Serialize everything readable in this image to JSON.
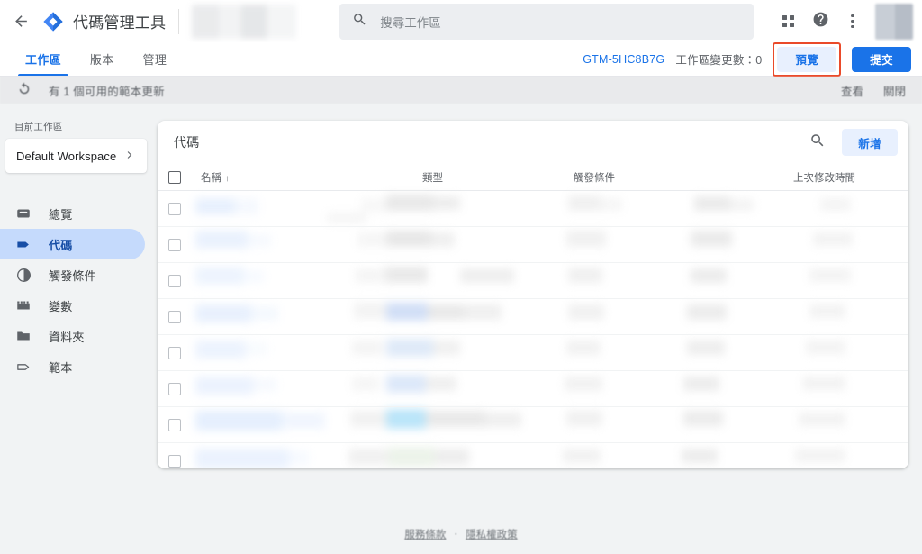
{
  "app": {
    "title": "代碼管理工具",
    "logo_icon": "gtm-diamond-icon",
    "back_icon": "back-arrow-icon"
  },
  "search": {
    "placeholder": "搜尋工作區",
    "value": "",
    "icon": "search-icon"
  },
  "topbar_right": {
    "apps_icon": "apps-grid-icon",
    "help_icon": "help-circle-icon",
    "more_icon": "more-vertical-icon",
    "avatar": "user-avatar"
  },
  "tabs": [
    {
      "label": "工作區",
      "active": true
    },
    {
      "label": "版本",
      "active": false
    },
    {
      "label": "管理",
      "active": false
    }
  ],
  "workspace_bar": {
    "container_id": "GTM-5HC8B7G",
    "changes_label": "工作區變更數：0",
    "preview_label": "預覽",
    "submit_label": "提交",
    "preview_highlight_color": "#ea4a2a"
  },
  "notification": {
    "icon": "update-refresh-icon",
    "message": "有 1 個可用的範本更新",
    "actions": [
      "查看",
      "關閉"
    ]
  },
  "sidebar": {
    "current_workspace_label": "目前工作區",
    "workspace_name": "Default Workspace",
    "workspace_chevron_icon": "chevron-right-icon",
    "items": [
      {
        "label": "總覽",
        "icon": "overview-box-icon",
        "active": false
      },
      {
        "label": "代碼",
        "icon": "tag-icon",
        "active": true
      },
      {
        "label": "觸發條件",
        "icon": "trigger-circle-icon",
        "active": false
      },
      {
        "label": "變數",
        "icon": "variables-icon",
        "active": false
      },
      {
        "label": "資料夾",
        "icon": "folder-icon",
        "active": false
      },
      {
        "label": "範本",
        "icon": "template-tag-icon",
        "active": false
      }
    ]
  },
  "main": {
    "card_title": "代碼",
    "search_icon": "search-icon",
    "add_label": "新增",
    "columns": [
      {
        "key": "checkbox",
        "label": ""
      },
      {
        "key": "name",
        "label": "名稱",
        "sort": "↑"
      },
      {
        "key": "type",
        "label": "類型"
      },
      {
        "key": "trigger",
        "label": "觸發條件"
      },
      {
        "key": "modified",
        "label": "上次修改時間"
      }
    ],
    "rows": [
      {
        "name": "",
        "type": "",
        "trigger": "",
        "modified": "",
        "selected": false
      },
      {
        "name": "",
        "type": "",
        "trigger": "",
        "modified": "",
        "selected": false
      },
      {
        "name": "",
        "type": "",
        "trigger": "",
        "modified": "",
        "selected": false
      },
      {
        "name": "",
        "type": "",
        "trigger": "",
        "modified": "",
        "selected": false
      },
      {
        "name": "",
        "type": "",
        "trigger": "",
        "modified": "",
        "selected": false
      },
      {
        "name": "",
        "type": "",
        "trigger": "",
        "modified": "",
        "selected": false
      },
      {
        "name": "",
        "type": "",
        "trigger": "",
        "modified": "",
        "selected": false
      },
      {
        "name": "",
        "type": "",
        "trigger": "",
        "modified": "",
        "selected": false
      }
    ],
    "rows_redacted": true
  },
  "footer": {
    "terms": "服務條款",
    "separator": "·",
    "privacy": "隱私權政策"
  },
  "colors": {
    "accent": "#1a73e8",
    "accent_soft": "#e8f0fe",
    "nav_active_bg": "#c5dafc",
    "page_bg": "#f1f3f4",
    "highlight": "#ea4a2a",
    "text_primary": "#3c4043",
    "text_secondary": "#5f6368"
  }
}
